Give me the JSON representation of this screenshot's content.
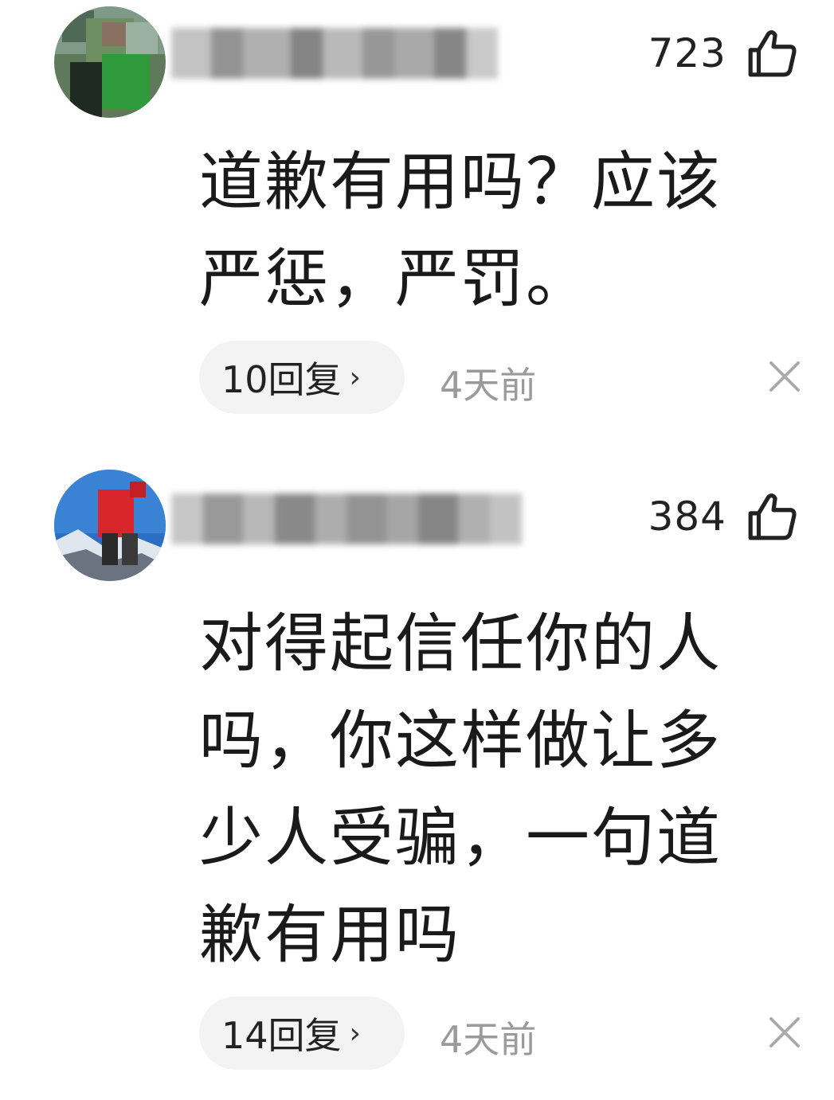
{
  "comments": [
    {
      "like_count": "723",
      "content_lines": [
        "道歉有用吗？应该",
        "严惩，严罚。"
      ],
      "reply_label": "10回复",
      "reply_chevron": "›",
      "time": "4天前",
      "avatar_icon": "avatar-blurred-person",
      "like_icon": "thumb-up-icon",
      "close_icon": "close-icon"
    },
    {
      "like_count": "384",
      "content_lines": [
        "对得起信任你的人",
        "吗，你这样做让多",
        "少人受骗，一句道",
        "歉有用吗"
      ],
      "reply_label": "14回复",
      "reply_chevron": "›",
      "time": "4天前",
      "avatar_icon": "avatar-mountain-climber",
      "like_icon": "thumb-up-icon",
      "close_icon": "close-icon"
    }
  ]
}
